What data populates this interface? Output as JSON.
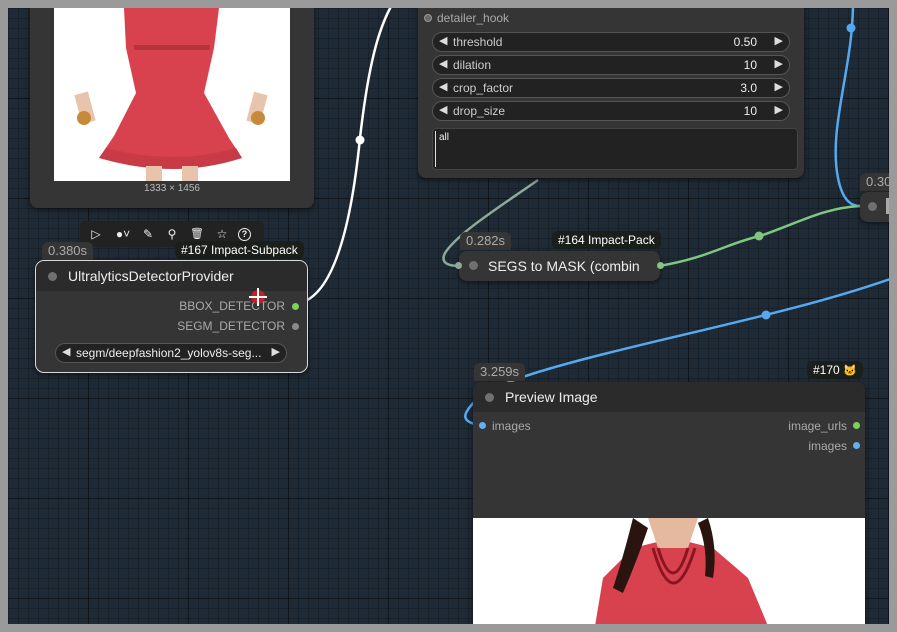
{
  "colors": {
    "canvas_bg": "#1e2a35",
    "node_bg": "#353535",
    "link_white": "#ffffff",
    "link_blue": "#55a9f0",
    "link_green": "#7fc77f",
    "link_gray": "#8ea89a",
    "slot_green": "#7ad454",
    "slot_blue": "#62b0f2"
  },
  "top_left_image": {
    "dimensions": "1333 × 1456"
  },
  "toolbar": {
    "icons": [
      "play-icon",
      "circle-dropdown-icon",
      "brush-icon",
      "pin-icon",
      "trash-icon",
      "star-icon",
      "help-icon"
    ],
    "labels": [
      "▷",
      "●˅",
      "✎",
      "⚲",
      "🗑",
      "☆",
      "?"
    ]
  },
  "detector_node": {
    "time": "0.380s",
    "badge": "#167 Impact-Subpack",
    "title": "UltralyticsDetectorProvider",
    "outputs": [
      "BBOX_DETECTOR",
      "SEGM_DETECTOR"
    ],
    "model_value": "segm/deepfashion2_yolov8s-seg..."
  },
  "detailer_node": {
    "input_label": "detailer_hook",
    "widgets": [
      {
        "label": "threshold",
        "value": "0.50"
      },
      {
        "label": "dilation",
        "value": "10"
      },
      {
        "label": "crop_factor",
        "value": "3.0"
      },
      {
        "label": "drop_size",
        "value": "10"
      }
    ],
    "text_value": "all"
  },
  "segs_node": {
    "time": "0.282s",
    "badge": "#164 Impact-Pack",
    "title": "SEGS to MASK (combin"
  },
  "right_node": {
    "time": "0.30"
  },
  "preview_node": {
    "time": "3.259s",
    "badge": "#170",
    "badge_icon": "🐱",
    "title": "Preview Image",
    "input": "images",
    "outputs": [
      "image_urls",
      "images"
    ]
  }
}
